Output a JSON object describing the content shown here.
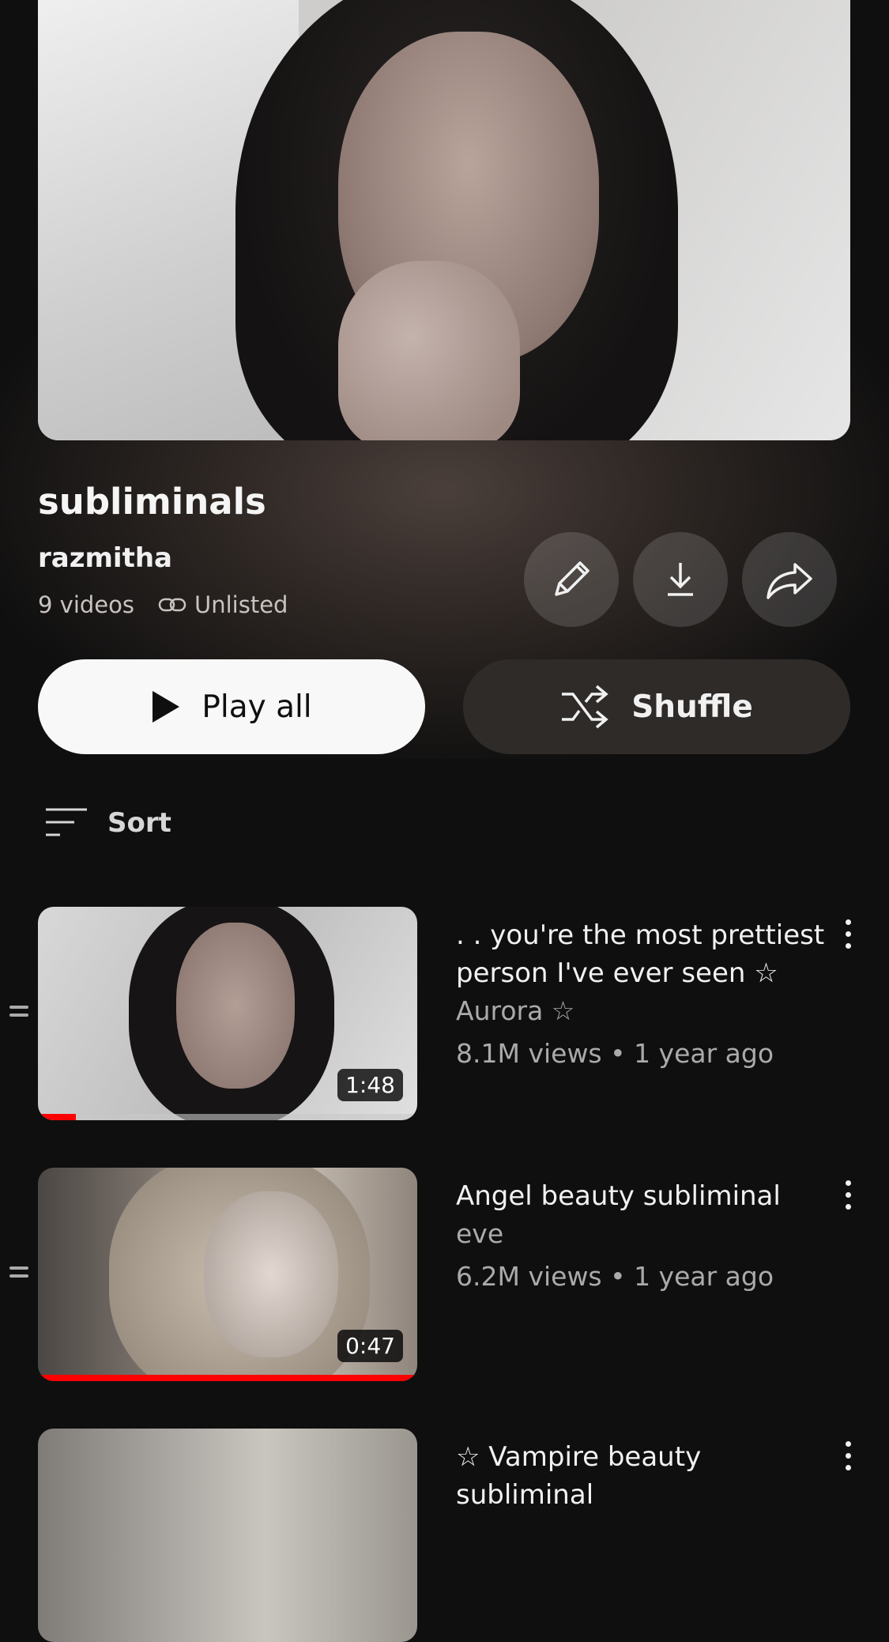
{
  "playlist": {
    "title": "subliminals",
    "owner": "razmitha",
    "video_count": "9 videos",
    "visibility": "Unlisted"
  },
  "actions": {
    "play_all": "Play all",
    "shuffle": "Shuffle",
    "sort": "Sort"
  },
  "icons": [
    "pencil-icon",
    "download-icon",
    "share-icon",
    "link-icon",
    "play-icon",
    "shuffle-icon",
    "sort-icon",
    "more-vert-icon",
    "drag-handle-icon"
  ],
  "videos": [
    {
      "title": ". . you're the most prettiest person I've ever seen ☆",
      "channel": "Aurora ☆",
      "stats": "8.1M views • 1 year ago",
      "duration": "1:48",
      "watched_fraction": 0.1
    },
    {
      "title": "Angel beauty subliminal",
      "channel": "eve",
      "stats": "6.2M views • 1 year ago",
      "duration": "0:47",
      "watched_fraction": 1.0
    },
    {
      "title": "☆ Vampire beauty subliminal"
    }
  ],
  "colors": {
    "accent": "#ff0000",
    "background": "#0f0f0f"
  }
}
